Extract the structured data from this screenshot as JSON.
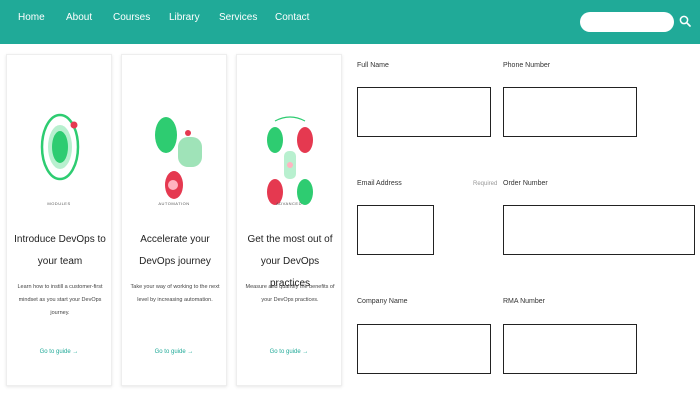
{
  "nav": {
    "links": [
      {
        "label": "Home"
      },
      {
        "label": "About"
      },
      {
        "label": "Courses"
      },
      {
        "label": "Library"
      },
      {
        "label": "Services"
      },
      {
        "label": "Contact"
      }
    ],
    "search": {
      "value": "",
      "placeholder": ""
    }
  },
  "cards": [
    {
      "tag": "Modules",
      "title": "Introduce DevOps to your team",
      "description": "Learn how to instill a customer-first mindset as you start your DevOps journey.",
      "link": "Go to guide →"
    },
    {
      "tag": "Automation",
      "title": "Accelerate your DevOps journey",
      "description": "Take your way of working to the next level by increasing automation.",
      "link": "Go to guide →"
    },
    {
      "tag": "Advanced",
      "title": "Get the most out of your DevOps practices",
      "description": "Measure and quantify the benefits of your DevOps practices.",
      "link": "Go to guide →"
    }
  ],
  "form": {
    "full_name_label": "Full Name",
    "phone_label": "Phone Number",
    "email_label": "Email Address",
    "email_note": "Required",
    "order_label": "Order Number",
    "company_label": "Company Name",
    "rma_label": "RMA Number"
  },
  "colors": {
    "nav_bg": "#20aa98",
    "accent": "#20aa98",
    "art_green": "#2ecc71",
    "art_red": "#e53950"
  }
}
